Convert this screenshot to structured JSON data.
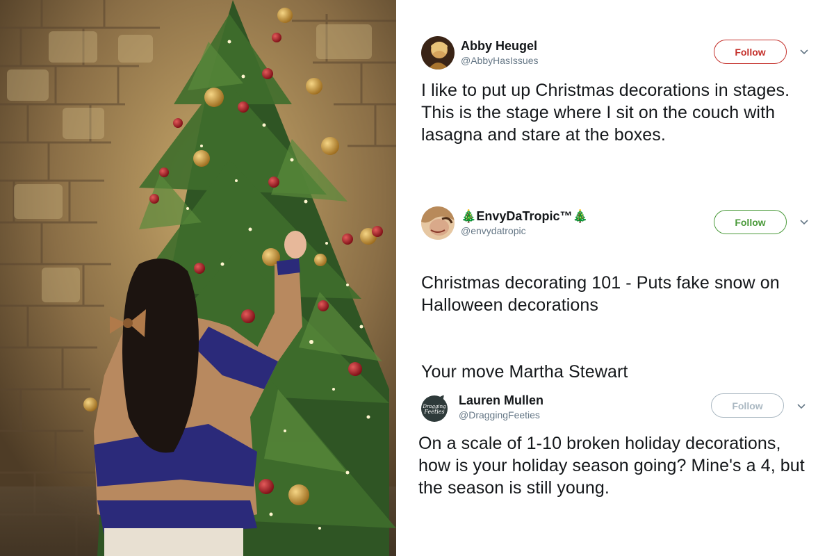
{
  "photo": {
    "description_icon": "christmas-tree-photo"
  },
  "tweets": [
    {
      "display_name": "Abby Heugel",
      "handle": "@AbbyHasIssues",
      "follow_label": "Follow",
      "follow_color": "#c4302b",
      "text": "I like to put up Christmas decorations in stages. This is the stage where I sit on the couch with lasagna and stare at the boxes."
    },
    {
      "display_name": "🎄EnvyDaTropic™🎄",
      "handle": "@envydatropic",
      "follow_label": "Follow",
      "follow_color": "#4a9a3a",
      "text_paragraphs": [
        "Christmas decorating 101 - Puts fake snow on Halloween decorations",
        "Your move Martha Stewart"
      ]
    },
    {
      "display_name": "Lauren Mullen",
      "handle": "@DraggingFeeties",
      "follow_label": "Follow",
      "follow_color": "#aab8c2",
      "avatar_text": "Dragging Feeties",
      "text": "On a scale of 1-10 broken holiday decorations, how is your holiday season going? Mine's a 4, but the season is still young."
    }
  ],
  "icons": {
    "caret": "chevron-down-icon"
  }
}
